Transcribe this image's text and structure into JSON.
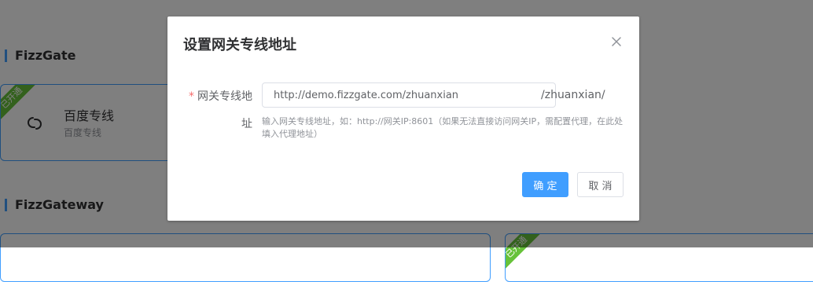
{
  "background": {
    "section1_title": "FizzGate",
    "card1": {
      "ribbon": "已开通",
      "title": "百度专线",
      "subtitle": "百度专线"
    },
    "section2_title": "FizzGateway",
    "card2": {
      "ribbon": "已开通"
    }
  },
  "dialog": {
    "title": "设置网关专线地址",
    "required_mark": "*",
    "label": "网关专线地",
    "label_wrap": "址",
    "input_value": "http://demo.fizzgate.com/zhuanxian",
    "suffix": "/zhuanxian/",
    "hint": "输入网关专线地址，如：http://网关IP:8601（如果无法直接访问网关IP，需配置代理，在此处填入代理地址）",
    "confirm_label": "确 定",
    "cancel_label": "取 消"
  },
  "colors": {
    "primary": "#409eff",
    "success": "#67c23a",
    "required": "#f56c6c",
    "overlay": "rgba(0,0,0,0.5)"
  },
  "icons": {
    "close": "close-icon",
    "link": "link-icon"
  }
}
